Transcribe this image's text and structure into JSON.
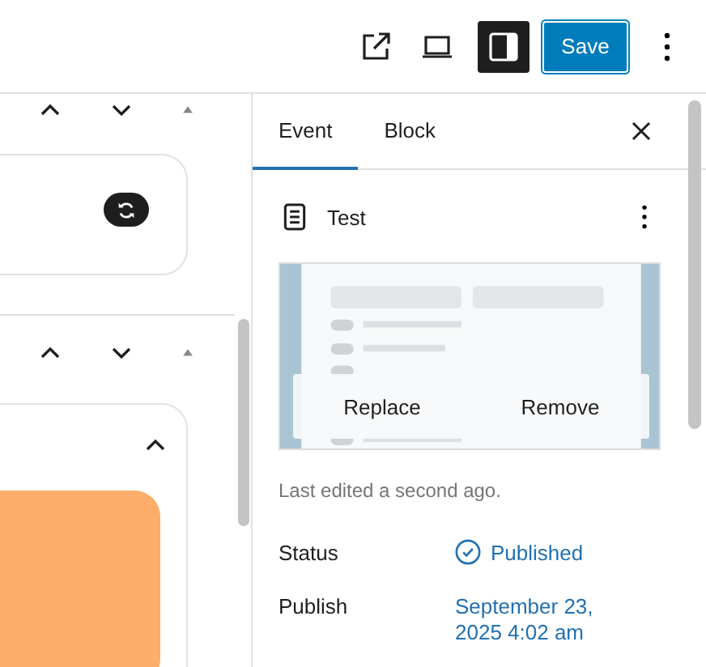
{
  "toolbar": {
    "sidebar_toggle": {
      "pressed": true
    },
    "save": "Save"
  },
  "sidebar": {
    "tabs": [
      {
        "label": "Event",
        "selected": true
      },
      {
        "label": "Block",
        "selected": false
      }
    ],
    "document": {
      "title": "Test"
    },
    "featured_image": {
      "kind": "picture",
      "actions": [
        "Replace",
        "Remove"
      ]
    },
    "last_edited": "Last edited a second ago.",
    "fields": [
      {
        "label": "Status",
        "value": "Published",
        "kind": "status"
      },
      {
        "label": "Publish",
        "value": "September 23, 2025 4:02 am",
        "kind": "date"
      }
    ]
  }
}
